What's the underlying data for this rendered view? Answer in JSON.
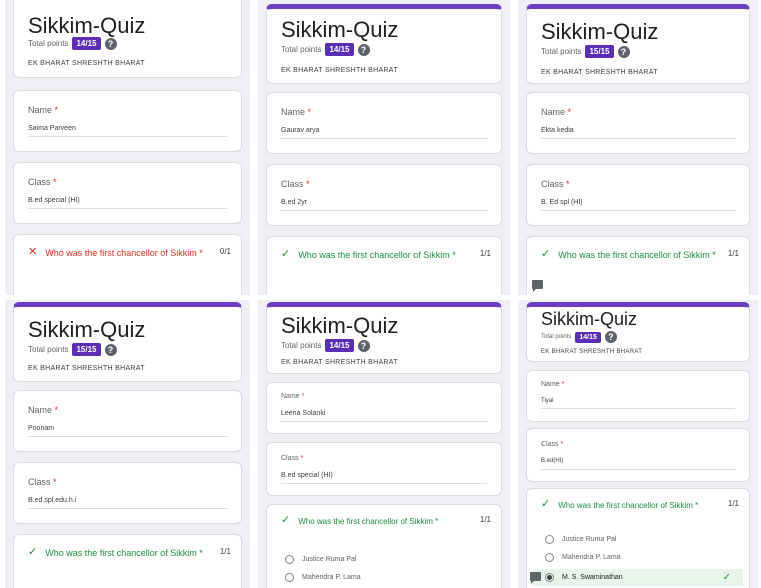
{
  "quiz_title": "Sikkim-Quiz",
  "points_label": "Total points",
  "subtitle": "EK BHARAT SHRESHTH BHARAT",
  "name_label": "Name",
  "class_label": "Class",
  "required_mark": "*",
  "question": "Who was the first chancellor of Sikkim",
  "colors": {
    "accent": "#6a3fc1",
    "badge": "#5b2fb5",
    "correct": "#1e8e3e",
    "incorrect": "#d93025"
  },
  "responses": [
    {
      "score": "14/15",
      "name": "Saima Parveen",
      "class": "B.ed special (HI)",
      "result": "incorrect",
      "question_score": "0/1"
    },
    {
      "score": "14/15",
      "name": "Gaurav arya",
      "class": "B.ed 2yr",
      "result": "correct",
      "question_score": "1/1"
    },
    {
      "score": "15/15",
      "name": "Ekta kedia",
      "class": "B. Ed spl (HI)",
      "result": "correct",
      "question_score": "1/1"
    },
    {
      "score": "15/15",
      "name": "Poonam",
      "class": "B.ed.spl.edu.h.i",
      "result": "correct",
      "question_score": "1/1"
    },
    {
      "score": "14/15",
      "name": "Leena Solanki",
      "class": "B.ed special (HI)",
      "result": "correct",
      "question_score": "1/1",
      "options": [
        "Justice Ruma Pal",
        "Mahendra P. Lama"
      ]
    },
    {
      "score": "14/15",
      "name": "Tiyal",
      "class": "B.ed(HI)",
      "result": "correct",
      "question_score": "1/1",
      "options": [
        "Justice Ruma Pal",
        "Mahendra P. Lama",
        "M. S. Swaminathan"
      ],
      "selected_option": "M. S. Swaminathan"
    }
  ]
}
